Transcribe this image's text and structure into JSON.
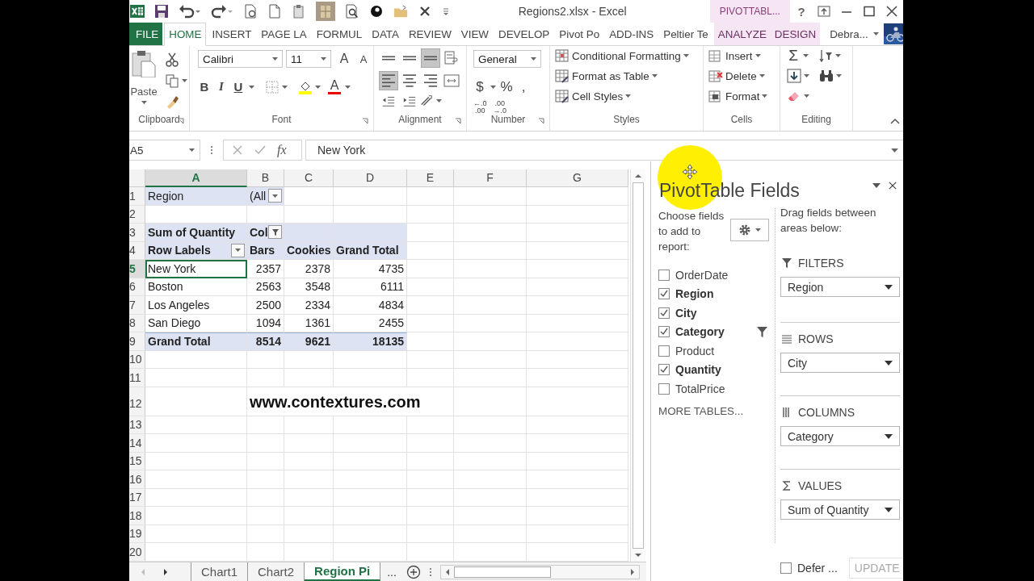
{
  "title_bar": {
    "title": "Regions2.xlsx - Excel",
    "context_label": "PIVOTTABL...",
    "help": "?"
  },
  "ribbon_tabs": [
    {
      "label": "FILE",
      "kind": "file",
      "selected": false
    },
    {
      "label": "HOME",
      "kind": "tab",
      "selected": true
    },
    {
      "label": "INSERT",
      "kind": "tab",
      "selected": false
    },
    {
      "label": "PAGE LA",
      "kind": "tab",
      "selected": false
    },
    {
      "label": "FORMUL",
      "kind": "tab",
      "selected": false
    },
    {
      "label": "DATA",
      "kind": "tab",
      "selected": false
    },
    {
      "label": "REVIEW",
      "kind": "tab",
      "selected": false
    },
    {
      "label": "VIEW",
      "kind": "tab",
      "selected": false
    },
    {
      "label": "DEVELOP",
      "kind": "tab",
      "selected": false
    },
    {
      "label": "Pivot Po",
      "kind": "tab",
      "selected": false
    },
    {
      "label": "ADD-INS",
      "kind": "tab",
      "selected": false
    },
    {
      "label": "Peltier Te",
      "kind": "tab",
      "selected": false
    },
    {
      "label": "ANALYZE",
      "kind": "context",
      "selected": false
    },
    {
      "label": "DESIGN",
      "kind": "context",
      "selected": false
    }
  ],
  "account": {
    "name": "Debra..."
  },
  "clipboard": {
    "paste": "Paste",
    "group": "Clipboard"
  },
  "font": {
    "name": "Calibri",
    "size": "11",
    "grow": "A",
    "shrink": "A",
    "bold": "B",
    "italic": "I",
    "underline": "U",
    "color_letter": "A",
    "group": "Font"
  },
  "alignment": {
    "group": "Alignment",
    "buttons": [
      {
        "kind": "top",
        "selected": false
      },
      {
        "kind": "middle",
        "selected": false
      },
      {
        "kind": "bottom",
        "selected": true
      },
      {
        "kind": "wrap",
        "selected": false
      },
      {
        "kind": "left",
        "selected": true
      },
      {
        "kind": "center",
        "selected": false
      },
      {
        "kind": "right",
        "selected": false
      },
      {
        "kind": "merge",
        "selected": false
      }
    ]
  },
  "number": {
    "format": "General",
    "currency": "$",
    "percent": "%",
    "comma": ",",
    "group": "Number",
    "decimals": [
      {
        "top": "←.0",
        "bottom": ".00"
      },
      {
        "top": ".00",
        "bottom": "→.0"
      }
    ]
  },
  "styles": {
    "group": "Styles",
    "buttons": [
      {
        "label": "Conditional Formatting",
        "kind": "conditional"
      },
      {
        "label": "Format as Table",
        "kind": "table"
      },
      {
        "label": "Cell Styles",
        "kind": "styles"
      }
    ]
  },
  "cells": {
    "group": "Cells",
    "buttons": [
      {
        "label": "Insert",
        "kind": "insert"
      },
      {
        "label": "Delete",
        "kind": "delete"
      },
      {
        "label": "Format",
        "kind": "format"
      }
    ]
  },
  "editing": {
    "sum": "Σ",
    "group": "Editing"
  },
  "formula_bar": {
    "name_box": "A5",
    "fx": "fx",
    "value": "New York"
  },
  "sheet": {
    "columns": [
      {
        "label": "A",
        "selected": true
      },
      {
        "label": "B",
        "selected": false
      },
      {
        "label": "C",
        "selected": false
      },
      {
        "label": "D",
        "selected": false
      },
      {
        "label": "E",
        "selected": false
      },
      {
        "label": "F",
        "selected": false
      },
      {
        "label": "G",
        "selected": false
      }
    ],
    "rows": [
      {
        "number": "1",
        "kind": "filter",
        "selected": false,
        "cells": [
          {
            "text": "Region"
          },
          {
            "text": "(All",
            "kind": "dropdown"
          }
        ]
      },
      {
        "number": "2",
        "kind": "blank",
        "selected": false,
        "cells": []
      },
      {
        "number": "3",
        "kind": "header",
        "selected": false,
        "cells": [
          {
            "text": "Sum of Quantity"
          },
          {
            "text": "Col",
            "kind": "filter"
          }
        ]
      },
      {
        "number": "4",
        "kind": "header",
        "selected": false,
        "cells": [
          {
            "text": "Row Labels",
            "kind": "dropdown"
          },
          {
            "text": "Bars"
          },
          {
            "text": "Cookies"
          },
          {
            "text": "Grand Total"
          }
        ]
      },
      {
        "number": "5",
        "kind": "data",
        "selected": true,
        "cells": [
          {
            "text": "New York"
          },
          {
            "text": "2357"
          },
          {
            "text": "2378"
          },
          {
            "text": "4735"
          }
        ]
      },
      {
        "number": "6",
        "kind": "data",
        "selected": false,
        "cells": [
          {
            "text": "Boston"
          },
          {
            "text": "2563"
          },
          {
            "text": "3548"
          },
          {
            "text": "6111"
          }
        ]
      },
      {
        "number": "7",
        "kind": "data",
        "selected": false,
        "cells": [
          {
            "text": "Los Angeles"
          },
          {
            "text": "2500"
          },
          {
            "text": "2334"
          },
          {
            "text": "4834"
          }
        ]
      },
      {
        "number": "8",
        "kind": "data",
        "selected": false,
        "cells": [
          {
            "text": "San Diego"
          },
          {
            "text": "1094"
          },
          {
            "text": "1361"
          },
          {
            "text": "2455"
          }
        ]
      },
      {
        "number": "9",
        "kind": "total",
        "selected": false,
        "cells": [
          {
            "text": "Grand Total"
          },
          {
            "text": "8514"
          },
          {
            "text": "9621"
          },
          {
            "text": "18135"
          }
        ]
      },
      {
        "number": "10",
        "kind": "blank",
        "selected": false,
        "cells": []
      },
      {
        "number": "11",
        "kind": "blank",
        "selected": false,
        "cells": []
      },
      {
        "number": "12",
        "kind": "note",
        "selected": false,
        "cells": [],
        "note": "www.contextures.com"
      },
      {
        "number": "13",
        "kind": "blank",
        "selected": false,
        "cells": []
      },
      {
        "number": "14",
        "kind": "blank",
        "selected": false,
        "cells": []
      },
      {
        "number": "15",
        "kind": "blank",
        "selected": false,
        "cells": []
      },
      {
        "number": "16",
        "kind": "blank",
        "selected": false,
        "cells": []
      },
      {
        "number": "17",
        "kind": "blank",
        "selected": false,
        "cells": []
      },
      {
        "number": "18",
        "kind": "blank",
        "selected": false,
        "cells": []
      },
      {
        "number": "19",
        "kind": "blank",
        "selected": false,
        "cells": []
      },
      {
        "number": "20",
        "kind": "blank",
        "selected": false,
        "cells": []
      }
    ]
  },
  "pivot_pane": {
    "title": "PivotTable Fields",
    "choose": "Choose fields to add to report:",
    "drag": "Drag fields between areas below:",
    "fields": [
      {
        "name": "OrderDate",
        "checked": false,
        "filtered": false
      },
      {
        "name": "Region",
        "checked": true,
        "filtered": false
      },
      {
        "name": "City",
        "checked": true,
        "filtered": false
      },
      {
        "name": "Category",
        "checked": true,
        "filtered": true
      },
      {
        "name": "Product",
        "checked": false,
        "filtered": false
      },
      {
        "name": "Quantity",
        "checked": true,
        "filtered": false
      },
      {
        "name": "TotalPrice",
        "checked": false,
        "filtered": false
      }
    ],
    "more_tables": "MORE TABLES...",
    "areas": [
      {
        "kind": "filters",
        "label": "FILTERS",
        "items": [
          "Region"
        ]
      },
      {
        "kind": "rows",
        "label": "ROWS",
        "items": [
          "City"
        ]
      },
      {
        "kind": "columns",
        "label": "COLUMNS",
        "items": [
          "Category"
        ]
      },
      {
        "kind": "values",
        "label": "VALUES",
        "items": [
          "Sum of Quantity"
        ]
      }
    ],
    "defer": {
      "label": "Defer ...",
      "checked": false
    },
    "update": {
      "label": "UPDATE",
      "disabled": true
    }
  },
  "sheet_tabs": {
    "tabs": [
      {
        "label": "Chart1",
        "selected": false
      },
      {
        "label": "Chart2",
        "selected": false
      },
      {
        "label": "Region Pi",
        "selected": true
      }
    ],
    "more": "..."
  }
}
